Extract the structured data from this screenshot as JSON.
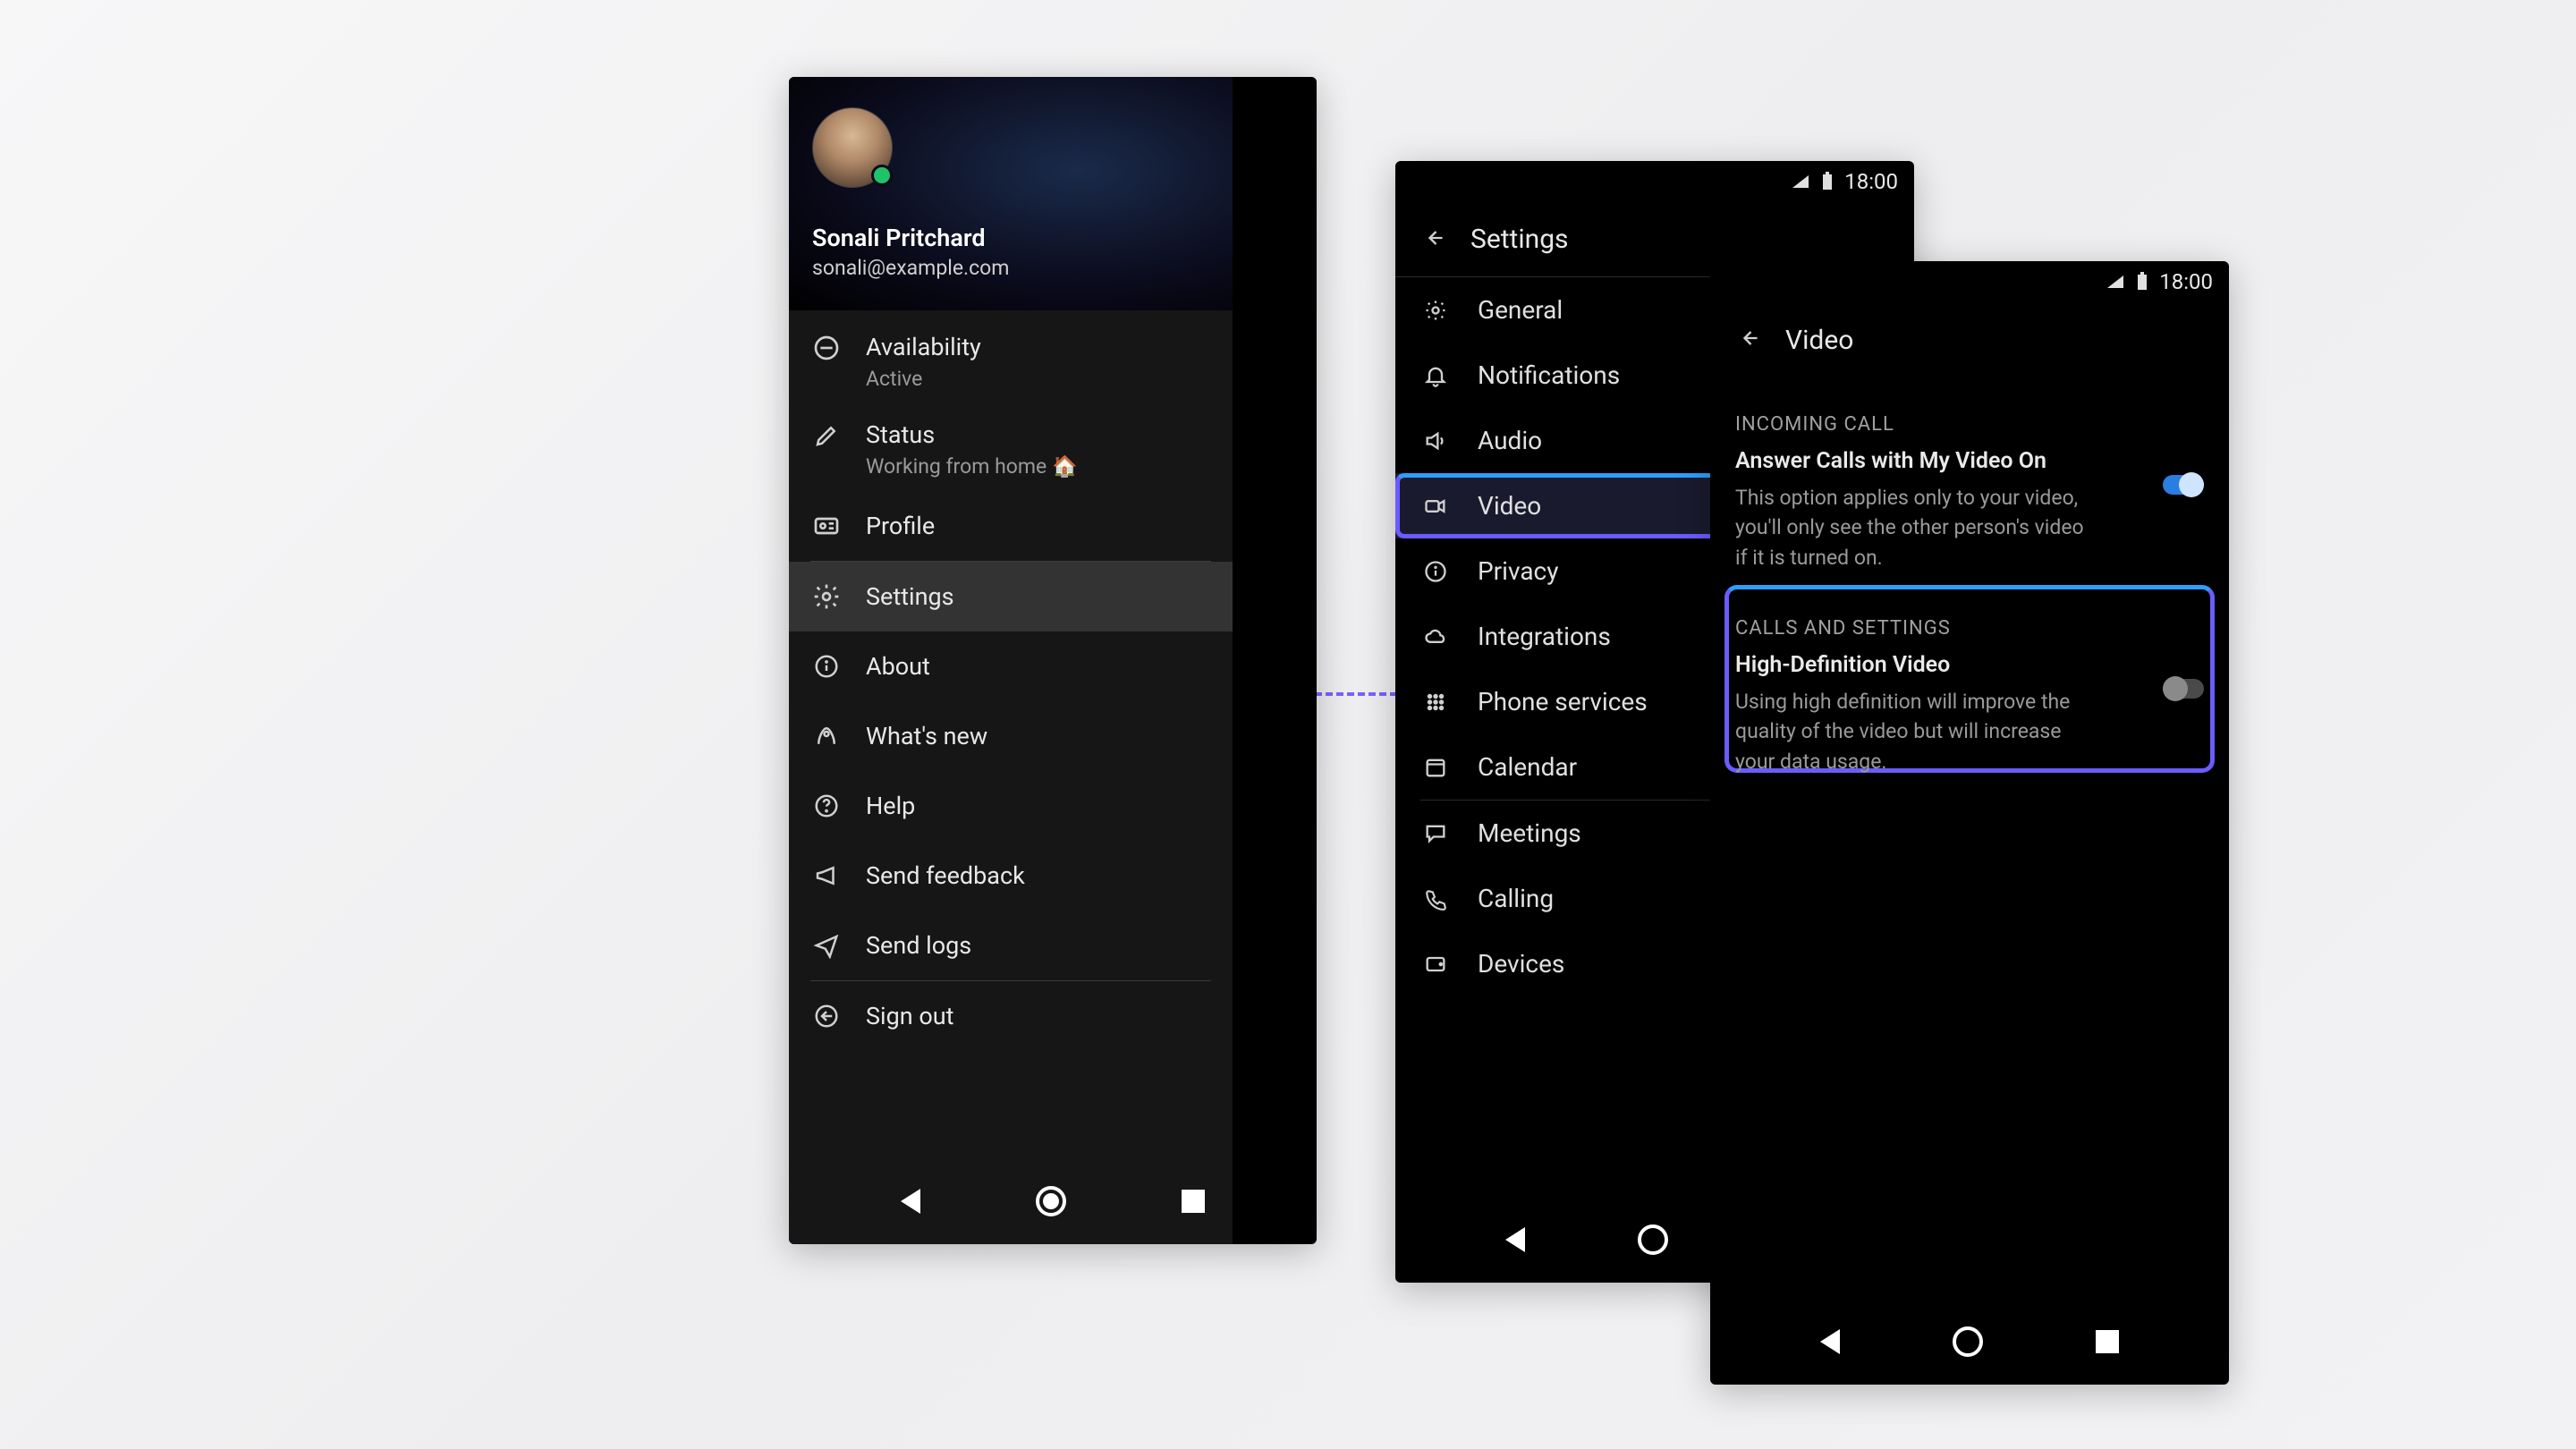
{
  "profile": {
    "name": "Sonali Pritchard",
    "email": "sonali@example.com"
  },
  "menu": {
    "availability": {
      "label": "Availability",
      "value": "Active"
    },
    "status": {
      "label": "Status",
      "value": "Working from home 🏠"
    },
    "profile": "Profile",
    "settings": "Settings",
    "about": "About",
    "whatsnew": "What's new",
    "help": "Help",
    "feedback": "Send feedback",
    "sendlogs": "Send logs",
    "signout": "Sign out"
  },
  "phone2": {
    "time": "18:00",
    "title": "Settings",
    "items": {
      "general": "General",
      "notifications": "Notifications",
      "audio": "Audio",
      "video": "Video",
      "privacy": "Privacy",
      "integrations": "Integrations",
      "phoneservices": "Phone services",
      "calendar": "Calendar",
      "meetings": "Meetings",
      "calling": "Calling",
      "devices": "Devices"
    }
  },
  "phone3": {
    "time": "18:00",
    "title": "Video",
    "section1": "INCOMING CALL",
    "answer": {
      "title": "Answer Calls with My Video On",
      "desc": "This option applies only to your video, you'll only see the other person's video if it is turned on."
    },
    "section2": "CALLS AND SETTINGS",
    "hd": {
      "title": "High-Definition Video",
      "desc": "Using high definition will improve the quality of the video but will increase your data usage."
    }
  }
}
